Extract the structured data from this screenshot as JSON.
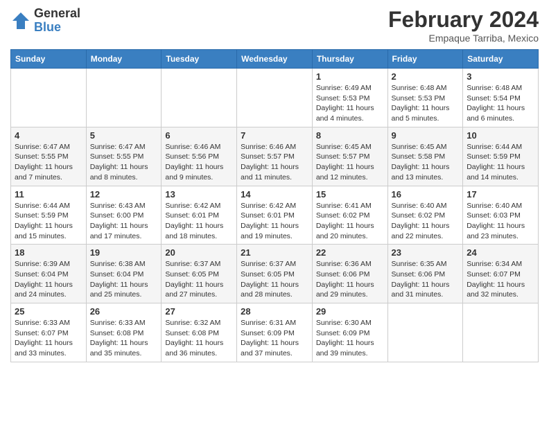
{
  "logo": {
    "general": "General",
    "blue": "Blue"
  },
  "title": "February 2024",
  "subtitle": "Empaque Tarriba, Mexico",
  "days_of_week": [
    "Sunday",
    "Monday",
    "Tuesday",
    "Wednesday",
    "Thursday",
    "Friday",
    "Saturday"
  ],
  "weeks": [
    [
      {
        "day": "",
        "info": ""
      },
      {
        "day": "",
        "info": ""
      },
      {
        "day": "",
        "info": ""
      },
      {
        "day": "",
        "info": ""
      },
      {
        "day": "1",
        "info": "Sunrise: 6:49 AM\nSunset: 5:53 PM\nDaylight: 11 hours and 4 minutes."
      },
      {
        "day": "2",
        "info": "Sunrise: 6:48 AM\nSunset: 5:53 PM\nDaylight: 11 hours and 5 minutes."
      },
      {
        "day": "3",
        "info": "Sunrise: 6:48 AM\nSunset: 5:54 PM\nDaylight: 11 hours and 6 minutes."
      }
    ],
    [
      {
        "day": "4",
        "info": "Sunrise: 6:47 AM\nSunset: 5:55 PM\nDaylight: 11 hours and 7 minutes."
      },
      {
        "day": "5",
        "info": "Sunrise: 6:47 AM\nSunset: 5:55 PM\nDaylight: 11 hours and 8 minutes."
      },
      {
        "day": "6",
        "info": "Sunrise: 6:46 AM\nSunset: 5:56 PM\nDaylight: 11 hours and 9 minutes."
      },
      {
        "day": "7",
        "info": "Sunrise: 6:46 AM\nSunset: 5:57 PM\nDaylight: 11 hours and 11 minutes."
      },
      {
        "day": "8",
        "info": "Sunrise: 6:45 AM\nSunset: 5:57 PM\nDaylight: 11 hours and 12 minutes."
      },
      {
        "day": "9",
        "info": "Sunrise: 6:45 AM\nSunset: 5:58 PM\nDaylight: 11 hours and 13 minutes."
      },
      {
        "day": "10",
        "info": "Sunrise: 6:44 AM\nSunset: 5:59 PM\nDaylight: 11 hours and 14 minutes."
      }
    ],
    [
      {
        "day": "11",
        "info": "Sunrise: 6:44 AM\nSunset: 5:59 PM\nDaylight: 11 hours and 15 minutes."
      },
      {
        "day": "12",
        "info": "Sunrise: 6:43 AM\nSunset: 6:00 PM\nDaylight: 11 hours and 17 minutes."
      },
      {
        "day": "13",
        "info": "Sunrise: 6:42 AM\nSunset: 6:01 PM\nDaylight: 11 hours and 18 minutes."
      },
      {
        "day": "14",
        "info": "Sunrise: 6:42 AM\nSunset: 6:01 PM\nDaylight: 11 hours and 19 minutes."
      },
      {
        "day": "15",
        "info": "Sunrise: 6:41 AM\nSunset: 6:02 PM\nDaylight: 11 hours and 20 minutes."
      },
      {
        "day": "16",
        "info": "Sunrise: 6:40 AM\nSunset: 6:02 PM\nDaylight: 11 hours and 22 minutes."
      },
      {
        "day": "17",
        "info": "Sunrise: 6:40 AM\nSunset: 6:03 PM\nDaylight: 11 hours and 23 minutes."
      }
    ],
    [
      {
        "day": "18",
        "info": "Sunrise: 6:39 AM\nSunset: 6:04 PM\nDaylight: 11 hours and 24 minutes."
      },
      {
        "day": "19",
        "info": "Sunrise: 6:38 AM\nSunset: 6:04 PM\nDaylight: 11 hours and 25 minutes."
      },
      {
        "day": "20",
        "info": "Sunrise: 6:37 AM\nSunset: 6:05 PM\nDaylight: 11 hours and 27 minutes."
      },
      {
        "day": "21",
        "info": "Sunrise: 6:37 AM\nSunset: 6:05 PM\nDaylight: 11 hours and 28 minutes."
      },
      {
        "day": "22",
        "info": "Sunrise: 6:36 AM\nSunset: 6:06 PM\nDaylight: 11 hours and 29 minutes."
      },
      {
        "day": "23",
        "info": "Sunrise: 6:35 AM\nSunset: 6:06 PM\nDaylight: 11 hours and 31 minutes."
      },
      {
        "day": "24",
        "info": "Sunrise: 6:34 AM\nSunset: 6:07 PM\nDaylight: 11 hours and 32 minutes."
      }
    ],
    [
      {
        "day": "25",
        "info": "Sunrise: 6:33 AM\nSunset: 6:07 PM\nDaylight: 11 hours and 33 minutes."
      },
      {
        "day": "26",
        "info": "Sunrise: 6:33 AM\nSunset: 6:08 PM\nDaylight: 11 hours and 35 minutes."
      },
      {
        "day": "27",
        "info": "Sunrise: 6:32 AM\nSunset: 6:08 PM\nDaylight: 11 hours and 36 minutes."
      },
      {
        "day": "28",
        "info": "Sunrise: 6:31 AM\nSunset: 6:09 PM\nDaylight: 11 hours and 37 minutes."
      },
      {
        "day": "29",
        "info": "Sunrise: 6:30 AM\nSunset: 6:09 PM\nDaylight: 11 hours and 39 minutes."
      },
      {
        "day": "",
        "info": ""
      },
      {
        "day": "",
        "info": ""
      }
    ]
  ]
}
